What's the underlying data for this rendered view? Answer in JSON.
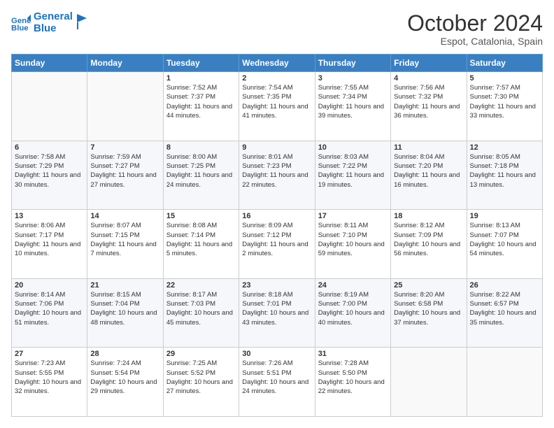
{
  "header": {
    "logo_line1": "General",
    "logo_line2": "Blue",
    "title": "October 2024",
    "subtitle": "Espot, Catalonia, Spain"
  },
  "days_of_week": [
    "Sunday",
    "Monday",
    "Tuesday",
    "Wednesday",
    "Thursday",
    "Friday",
    "Saturday"
  ],
  "weeks": [
    [
      {
        "day": "",
        "info": ""
      },
      {
        "day": "",
        "info": ""
      },
      {
        "day": "1",
        "info": "Sunrise: 7:52 AM\nSunset: 7:37 PM\nDaylight: 11 hours and 44 minutes."
      },
      {
        "day": "2",
        "info": "Sunrise: 7:54 AM\nSunset: 7:35 PM\nDaylight: 11 hours and 41 minutes."
      },
      {
        "day": "3",
        "info": "Sunrise: 7:55 AM\nSunset: 7:34 PM\nDaylight: 11 hours and 39 minutes."
      },
      {
        "day": "4",
        "info": "Sunrise: 7:56 AM\nSunset: 7:32 PM\nDaylight: 11 hours and 36 minutes."
      },
      {
        "day": "5",
        "info": "Sunrise: 7:57 AM\nSunset: 7:30 PM\nDaylight: 11 hours and 33 minutes."
      }
    ],
    [
      {
        "day": "6",
        "info": "Sunrise: 7:58 AM\nSunset: 7:29 PM\nDaylight: 11 hours and 30 minutes."
      },
      {
        "day": "7",
        "info": "Sunrise: 7:59 AM\nSunset: 7:27 PM\nDaylight: 11 hours and 27 minutes."
      },
      {
        "day": "8",
        "info": "Sunrise: 8:00 AM\nSunset: 7:25 PM\nDaylight: 11 hours and 24 minutes."
      },
      {
        "day": "9",
        "info": "Sunrise: 8:01 AM\nSunset: 7:23 PM\nDaylight: 11 hours and 22 minutes."
      },
      {
        "day": "10",
        "info": "Sunrise: 8:03 AM\nSunset: 7:22 PM\nDaylight: 11 hours and 19 minutes."
      },
      {
        "day": "11",
        "info": "Sunrise: 8:04 AM\nSunset: 7:20 PM\nDaylight: 11 hours and 16 minutes."
      },
      {
        "day": "12",
        "info": "Sunrise: 8:05 AM\nSunset: 7:18 PM\nDaylight: 11 hours and 13 minutes."
      }
    ],
    [
      {
        "day": "13",
        "info": "Sunrise: 8:06 AM\nSunset: 7:17 PM\nDaylight: 11 hours and 10 minutes."
      },
      {
        "day": "14",
        "info": "Sunrise: 8:07 AM\nSunset: 7:15 PM\nDaylight: 11 hours and 7 minutes."
      },
      {
        "day": "15",
        "info": "Sunrise: 8:08 AM\nSunset: 7:14 PM\nDaylight: 11 hours and 5 minutes."
      },
      {
        "day": "16",
        "info": "Sunrise: 8:09 AM\nSunset: 7:12 PM\nDaylight: 11 hours and 2 minutes."
      },
      {
        "day": "17",
        "info": "Sunrise: 8:11 AM\nSunset: 7:10 PM\nDaylight: 10 hours and 59 minutes."
      },
      {
        "day": "18",
        "info": "Sunrise: 8:12 AM\nSunset: 7:09 PM\nDaylight: 10 hours and 56 minutes."
      },
      {
        "day": "19",
        "info": "Sunrise: 8:13 AM\nSunset: 7:07 PM\nDaylight: 10 hours and 54 minutes."
      }
    ],
    [
      {
        "day": "20",
        "info": "Sunrise: 8:14 AM\nSunset: 7:06 PM\nDaylight: 10 hours and 51 minutes."
      },
      {
        "day": "21",
        "info": "Sunrise: 8:15 AM\nSunset: 7:04 PM\nDaylight: 10 hours and 48 minutes."
      },
      {
        "day": "22",
        "info": "Sunrise: 8:17 AM\nSunset: 7:03 PM\nDaylight: 10 hours and 45 minutes."
      },
      {
        "day": "23",
        "info": "Sunrise: 8:18 AM\nSunset: 7:01 PM\nDaylight: 10 hours and 43 minutes."
      },
      {
        "day": "24",
        "info": "Sunrise: 8:19 AM\nSunset: 7:00 PM\nDaylight: 10 hours and 40 minutes."
      },
      {
        "day": "25",
        "info": "Sunrise: 8:20 AM\nSunset: 6:58 PM\nDaylight: 10 hours and 37 minutes."
      },
      {
        "day": "26",
        "info": "Sunrise: 8:22 AM\nSunset: 6:57 PM\nDaylight: 10 hours and 35 minutes."
      }
    ],
    [
      {
        "day": "27",
        "info": "Sunrise: 7:23 AM\nSunset: 5:55 PM\nDaylight: 10 hours and 32 minutes."
      },
      {
        "day": "28",
        "info": "Sunrise: 7:24 AM\nSunset: 5:54 PM\nDaylight: 10 hours and 29 minutes."
      },
      {
        "day": "29",
        "info": "Sunrise: 7:25 AM\nSunset: 5:52 PM\nDaylight: 10 hours and 27 minutes."
      },
      {
        "day": "30",
        "info": "Sunrise: 7:26 AM\nSunset: 5:51 PM\nDaylight: 10 hours and 24 minutes."
      },
      {
        "day": "31",
        "info": "Sunrise: 7:28 AM\nSunset: 5:50 PM\nDaylight: 10 hours and 22 minutes."
      },
      {
        "day": "",
        "info": ""
      },
      {
        "day": "",
        "info": ""
      }
    ]
  ]
}
